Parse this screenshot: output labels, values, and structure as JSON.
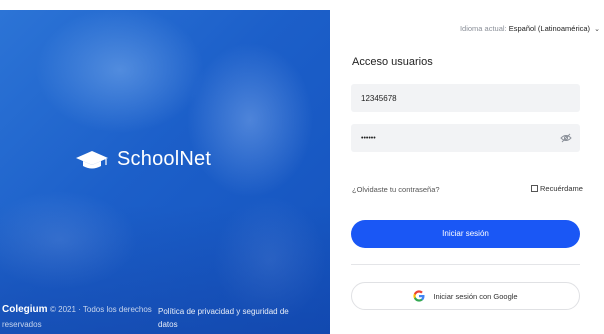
{
  "hero": {
    "brand_name": "SchoolNet",
    "footer": {
      "logo_text": "Colegium",
      "copyright": "© 2021 · Todos los derechos",
      "copyright_cont": "reservados",
      "policy_link": "Política de privacidad y seguridad de datos"
    }
  },
  "language": {
    "prefix": "Idioma actual:",
    "value": "Español (Latinoamérica)"
  },
  "login": {
    "title": "Acceso usuarios",
    "username_value": "12345678",
    "password_value": "••••••",
    "forgot_link": "¿Olvidaste tu contraseña?",
    "remember_label": "Recuérdame",
    "remember_checked": false,
    "submit_label": "Iniciar sesión",
    "google_label": "Iniciar sesión con Google"
  },
  "colors": {
    "primary": "#1a57f5",
    "hero_blue": "#1c5fc9"
  }
}
